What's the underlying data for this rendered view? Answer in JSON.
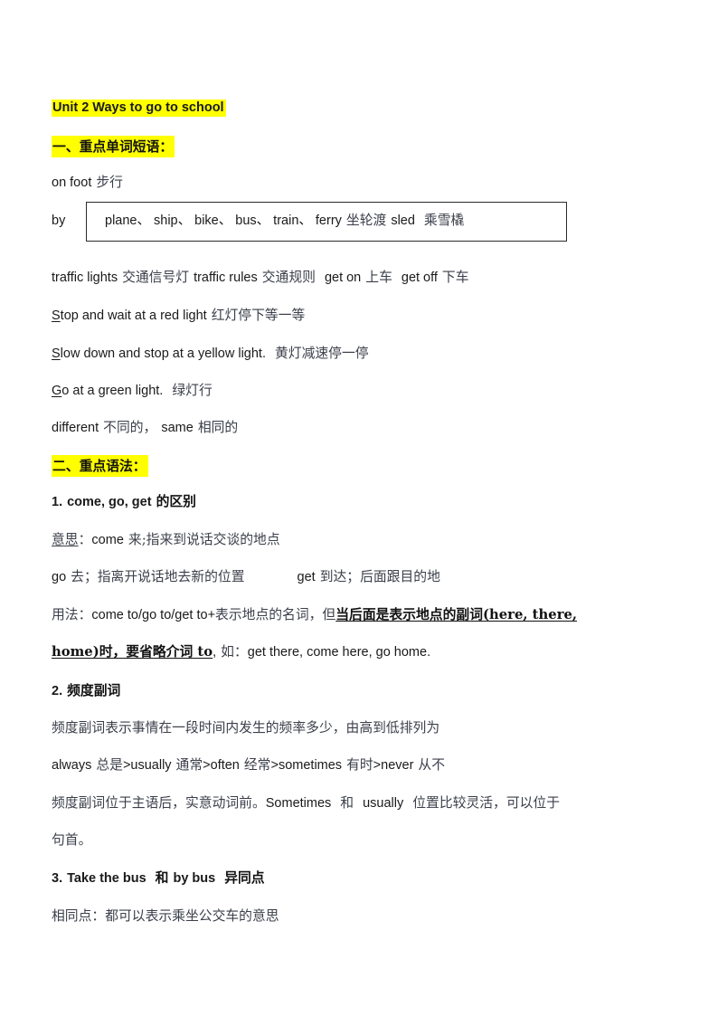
{
  "document": {
    "title": "Unit 2 Ways to go to school",
    "page_background": "#ffffff",
    "highlight_color": "#FFFF00"
  },
  "sections": {
    "vocab_heading": "一、重点单词短语：",
    "grammar_heading": "二、重点语法："
  },
  "vocab": {
    "on_foot_en": "on foot",
    "on_foot_cn": "步行",
    "by_label": "by",
    "by_box_en1": "plane、 ship、 bike、 bus、 train、 ferry",
    "by_box_cn1": "坐轮渡",
    "by_box_en2": "sled",
    "by_box_cn2": "乘雪橇",
    "traffic_lights_en": "traffic lights",
    "traffic_lights_cn": "交通信号灯",
    "traffic_rules_en": "traffic rules",
    "traffic_rules_cn": "交通规则",
    "get_on_en": "get on",
    "get_on_cn": "上车",
    "get_off_en": "get off",
    "get_off_cn": "下车",
    "stop_initial": "S",
    "stop_rest": "top and wait at a red light",
    "stop_cn": "红灯停下等一等",
    "slow_initial": "S",
    "slow_rest": "low down and stop at a yellow light.",
    "slow_cn": "黄灯减速停一停",
    "go_initial": "G",
    "go_rest": "o at a green light.",
    "go_cn": "绿灯行",
    "different_en": "different",
    "different_cn": "不同的，",
    "same_en": "same",
    "same_cn": "相同的"
  },
  "grammar": {
    "point1_num": "1.",
    "point1_en": "come, go, get",
    "point1_cn": "的区别",
    "meaning_label": "意思",
    "meaning_colon": "：",
    "come_en": "come",
    "come_cn": "来;指来到说话交谈的地点",
    "go_en": "go",
    "go_cn": "去；指离开说话地去新的位置",
    "get_en": "get",
    "get_cn": "到达；后面跟目的地",
    "usage_label": "用法：",
    "usage_en1": "come to/go to/get to+",
    "usage_cn1": "表示地点的名词，但",
    "usage_bold1": "当后面是表示地点的副词(here, there,",
    "usage_bold2": "home)时，要省略介词 to",
    "usage_comma": ",",
    "usage_cn2": "如：",
    "usage_en2": "get there, come here, go home.",
    "point2_num": "2.",
    "point2_cn": "频度副词",
    "freq_desc": "频度副词表示事情在一段时间内发生的频率多少，由高到低排列为",
    "freq_always_en": "always",
    "freq_always_cn": "总是",
    "freq_gt1": ">",
    "freq_usually_en": "usually",
    "freq_usually_cn": "通常",
    "freq_gt2": ">",
    "freq_often_en": "often",
    "freq_often_cn": "经常",
    "freq_gt3": ">",
    "freq_sometimes_en": "sometimes",
    "freq_sometimes_cn": "有时",
    "freq_gt4": ">",
    "freq_never_en": "never",
    "freq_never_cn": "从不",
    "freq_pos_cn1": "频度副词位于主语后，实意动词前。",
    "freq_pos_en1": "Sometimes",
    "freq_pos_cn2": "和",
    "freq_pos_en2": "usually",
    "freq_pos_cn3": "位置比较灵活，可以位于",
    "freq_pos_cn4": "句首。",
    "point3_num": "3.",
    "point3_en1": "Take the bus",
    "point3_cn1": "和",
    "point3_en2": "by bus",
    "point3_cn2": "异同点",
    "same_point_cn": "相同点：都可以表示乘坐公交车的意思"
  }
}
